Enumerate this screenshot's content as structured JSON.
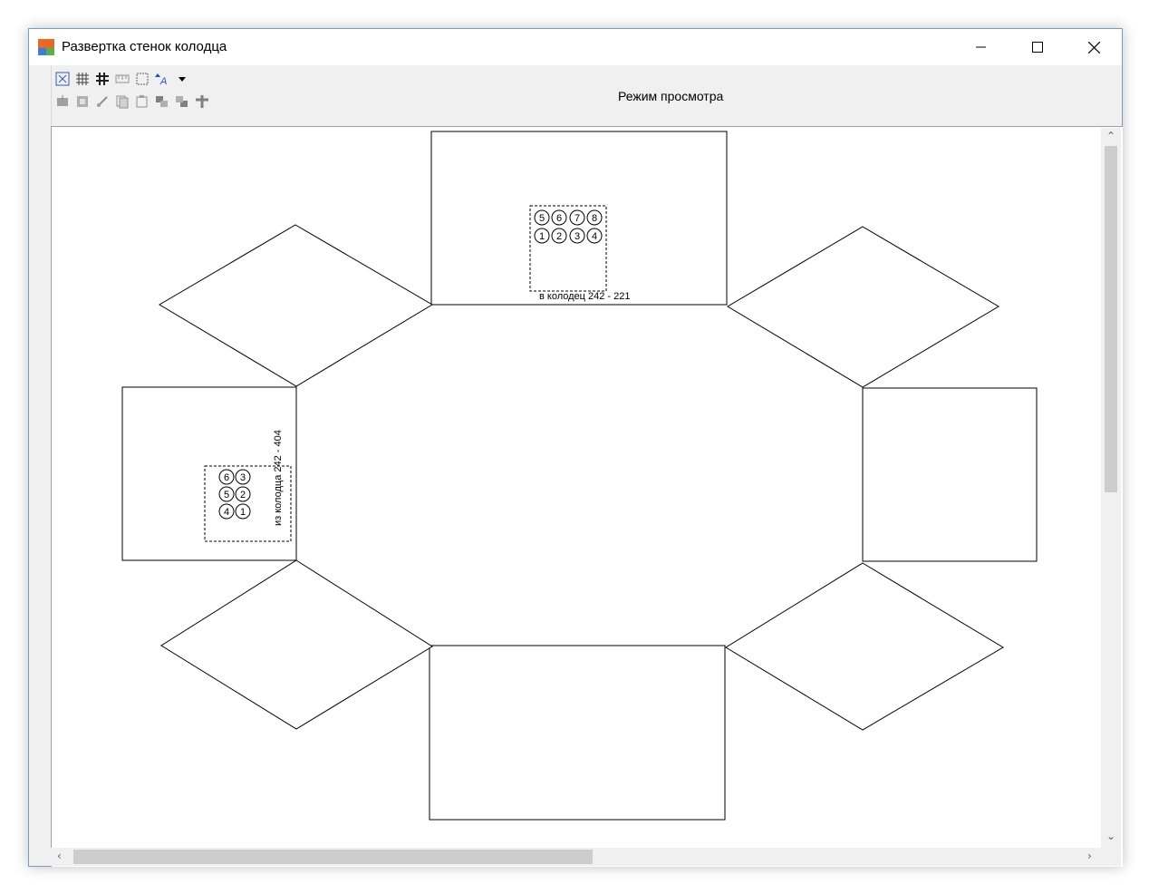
{
  "window": {
    "title": "Развертка стенок колодца"
  },
  "toolbar": {
    "mode_label": "Режим просмотра",
    "row1_icons": [
      "select-icon",
      "grid-icon",
      "grid-bold-icon",
      "ruler-icon",
      "frame-icon",
      "sort-text-icon",
      "dropdown-arrow-icon"
    ],
    "row2_icons": [
      "insert-icon",
      "insert-group-icon",
      "edit-icon",
      "copy-icon",
      "paste-icon",
      "move-back-icon",
      "move-front-icon",
      "cross-icon"
    ]
  },
  "drawing": {
    "top_wall": {
      "label": "в колодец 242 - 221",
      "ports_top": [
        "5",
        "6",
        "7",
        "8"
      ],
      "ports_bottom": [
        "1",
        "2",
        "3",
        "4"
      ]
    },
    "left_wall": {
      "label": "из колодца 242 - 404",
      "ports_col1": [
        "6",
        "5",
        "4"
      ],
      "ports_col2": [
        "3",
        "2",
        "1"
      ]
    }
  }
}
